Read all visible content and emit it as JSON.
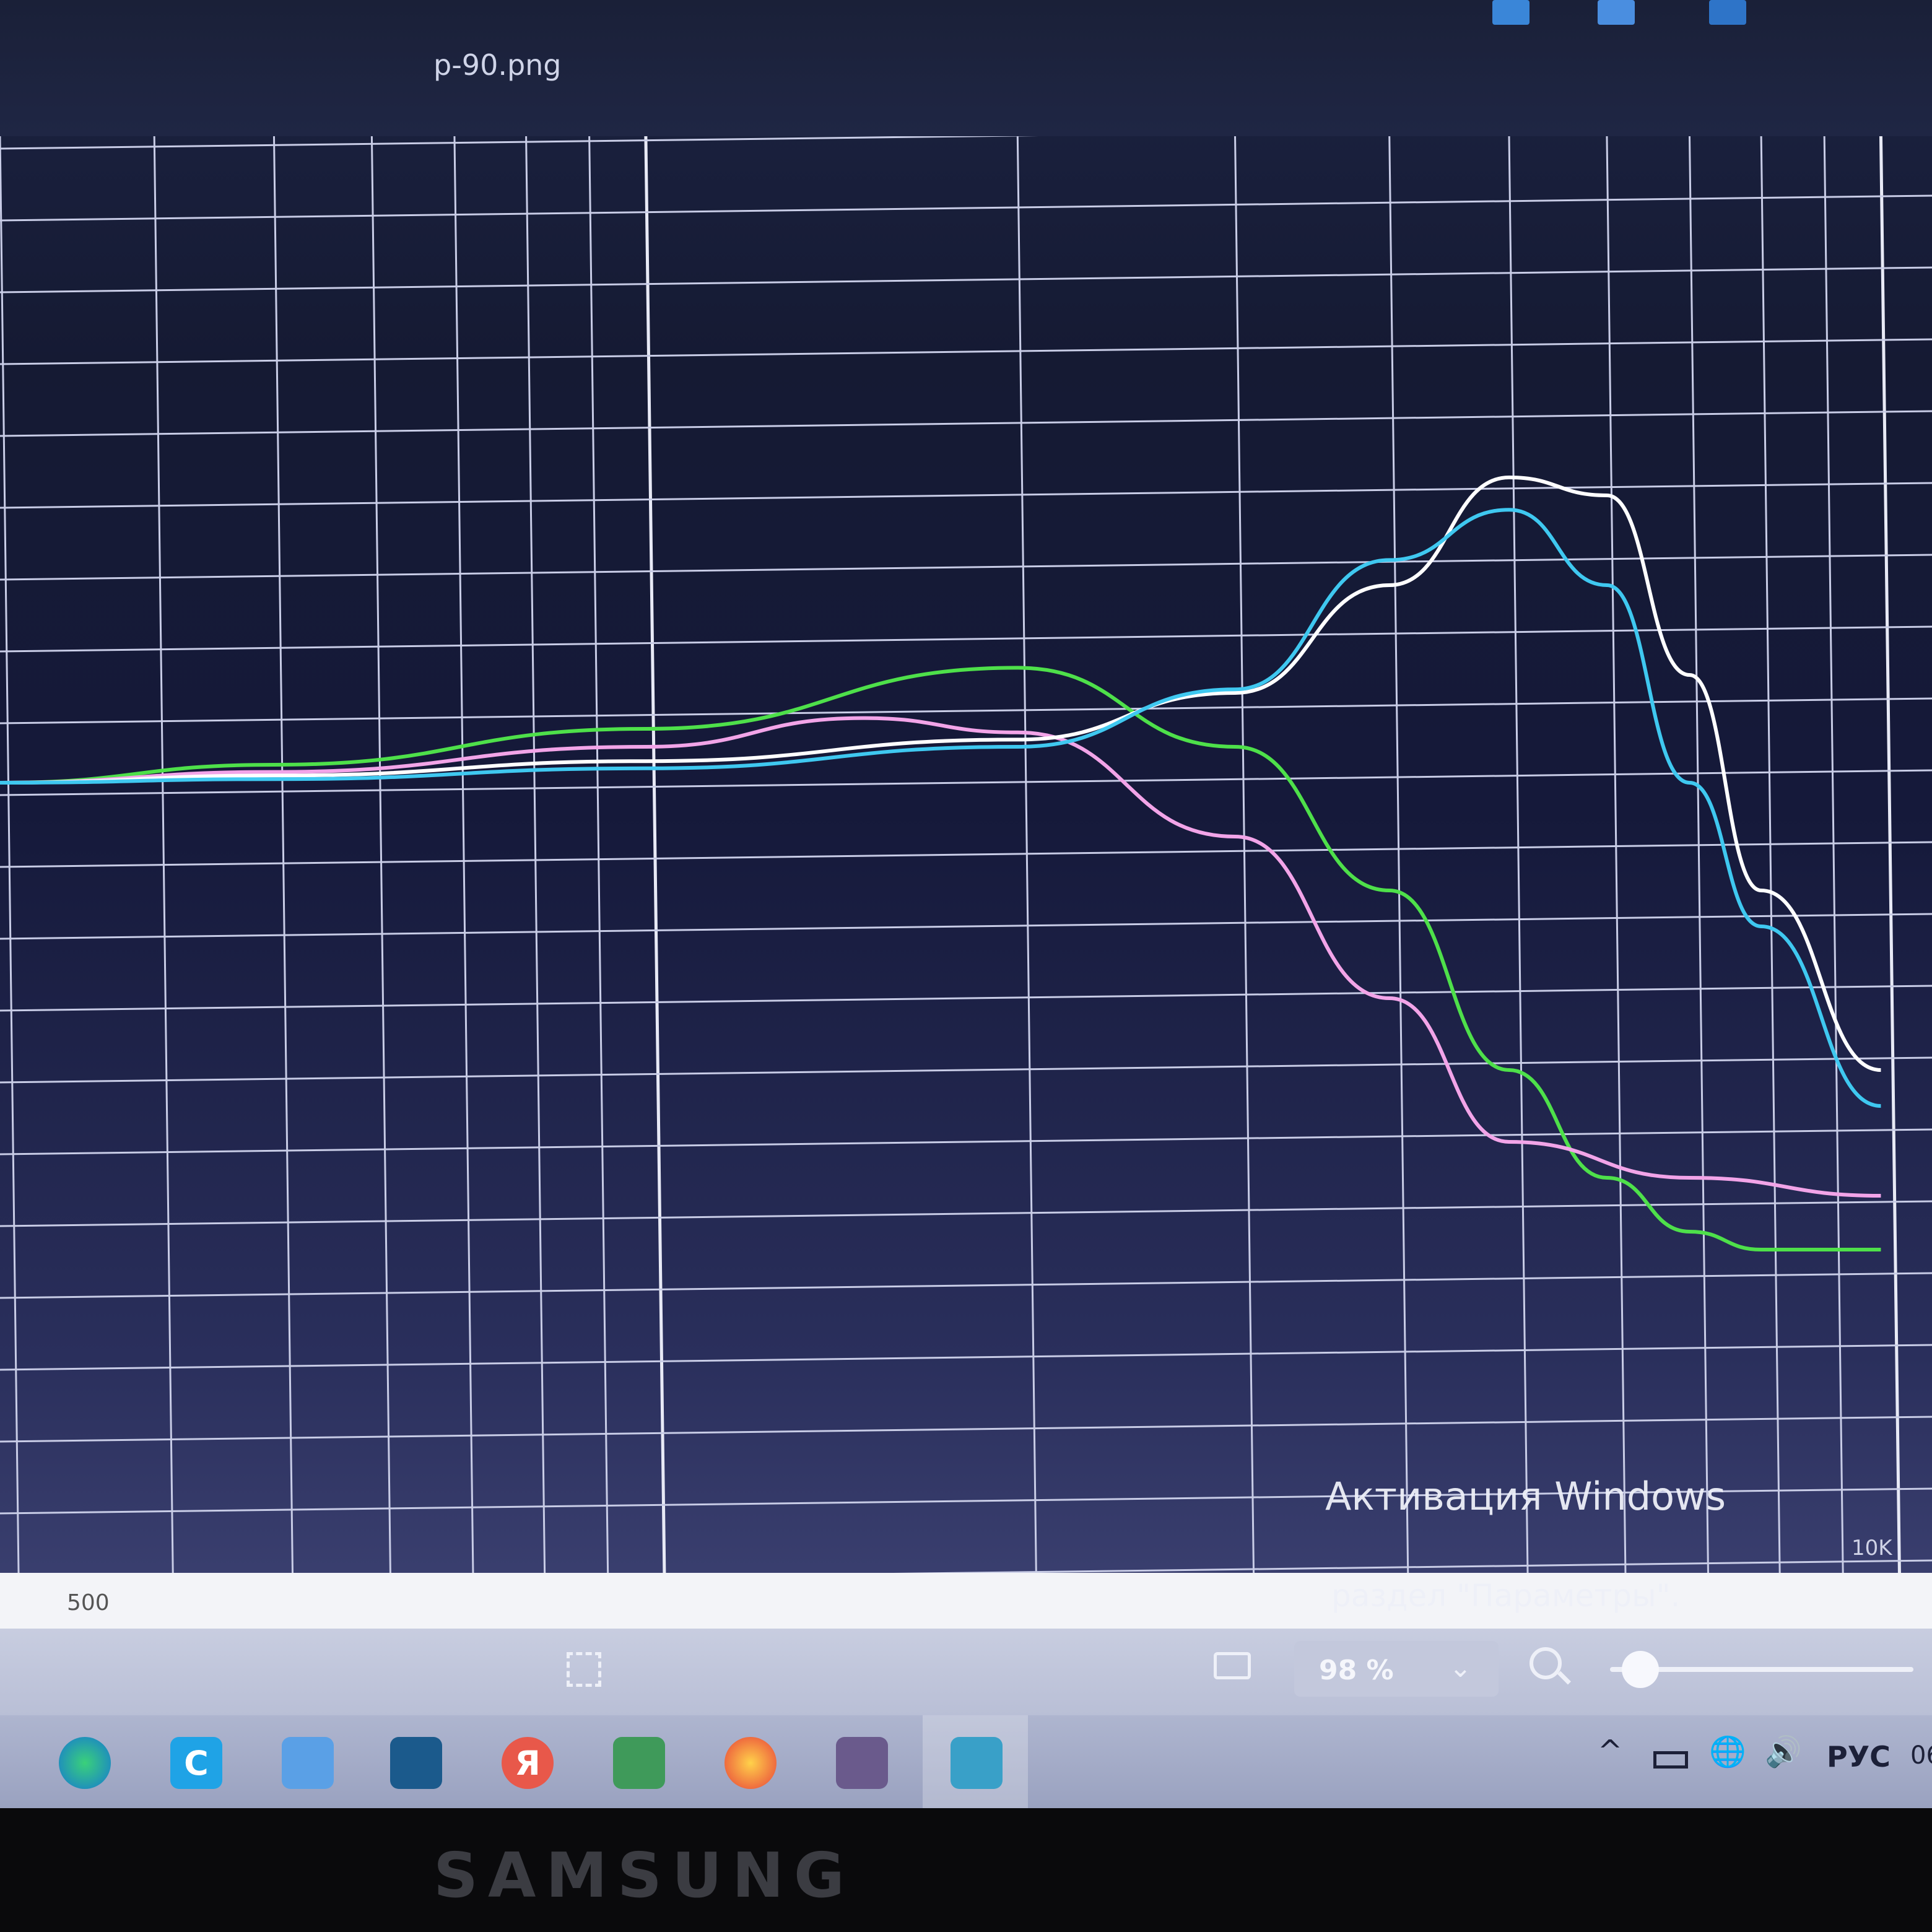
{
  "window": {
    "title": "p-90.png"
  },
  "chart_data": {
    "type": "line",
    "title": "",
    "xlabel": "",
    "ylabel": "",
    "x_scale": "log",
    "x_tick_labels": [
      "500",
      "10K"
    ],
    "grid": true,
    "legend": "none",
    "colors": {
      "green": "#4ee04a",
      "pink": "#f2a4e8",
      "white": "#ffffff",
      "cyan": "#3fc8f0"
    },
    "series": [
      {
        "color": "green",
        "x": [
          300,
          500,
          1000,
          2000,
          3000,
          4000,
          5000,
          6000,
          7000,
          8000,
          10000
        ],
        "y": [
          0.0,
          0.5,
          1.5,
          3.2,
          1.0,
          -3.0,
          -8.0,
          -11.0,
          -12.5,
          -13.0,
          -13.0
        ]
      },
      {
        "color": "pink",
        "x": [
          300,
          500,
          1000,
          1500,
          2000,
          3000,
          4000,
          5000,
          7000,
          10000
        ],
        "y": [
          0.0,
          0.3,
          1.0,
          1.8,
          1.4,
          -1.5,
          -6.0,
          -10.0,
          -11.0,
          -11.5
        ]
      },
      {
        "color": "white",
        "x": [
          300,
          500,
          1000,
          2000,
          3000,
          4000,
          5000,
          6000,
          7000,
          8000,
          10000
        ],
        "y": [
          0.0,
          0.2,
          0.6,
          1.2,
          2.5,
          5.5,
          8.5,
          8.0,
          3.0,
          -3.0,
          -8.0
        ]
      },
      {
        "color": "cyan",
        "x": [
          300,
          500,
          1000,
          2000,
          3000,
          4000,
          5000,
          6000,
          7000,
          8000,
          10000
        ],
        "y": [
          0.0,
          0.1,
          0.4,
          1.0,
          2.6,
          6.2,
          7.6,
          5.5,
          0.0,
          -4.0,
          -9.0
        ]
      }
    ]
  },
  "axis": {
    "tick_500": "500",
    "tick_10k": "10K"
  },
  "statusbar": {
    "zoom_value": "98 %",
    "zoom_chevron": "⌄",
    "zoom_level": 0.1
  },
  "watermark": {
    "title": "Активация Windows",
    "subtitle": "раздел \"Параметры\"."
  },
  "taskbar": {
    "icons": [
      "edge-icon",
      "c-app-icon",
      "calculator-icon",
      "sketchup-icon",
      "yandex-icon",
      "excel-icon",
      "yandex-browser-icon",
      "design-app-icon",
      "photos-icon"
    ],
    "yandex_letter": "Я",
    "c_letter": "C"
  },
  "tray": {
    "chevron": "^",
    "language": "РУС",
    "volume": "🔊",
    "globe": "🌐",
    "clock_fragment": "06"
  },
  "device": {
    "brand": "SAMSUNG"
  }
}
